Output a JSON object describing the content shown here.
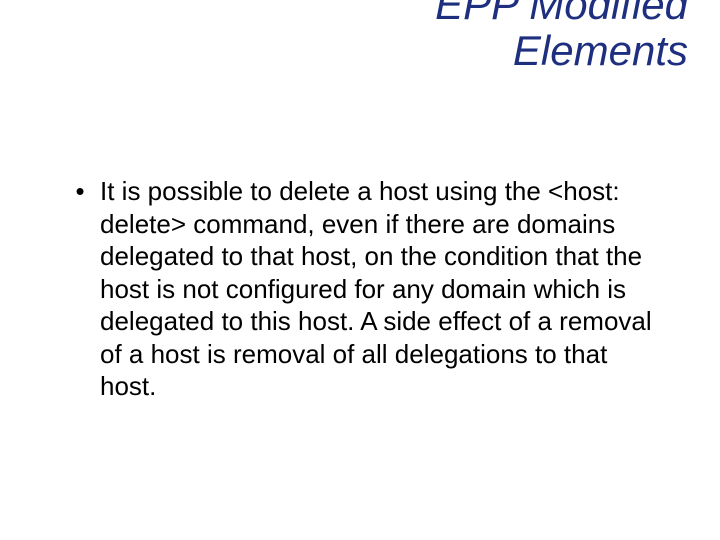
{
  "title_line1": "EPP Modified",
  "title_line2": "Elements",
  "bullet_marker": "•",
  "body_text": "It is possible to delete a host using the <host: delete> command, even if there are domains delegated to that host, on the condition that the host is not configured for any domain which is delegated to this host. A side effect of a removal of a host is removal of all delegations to that host."
}
